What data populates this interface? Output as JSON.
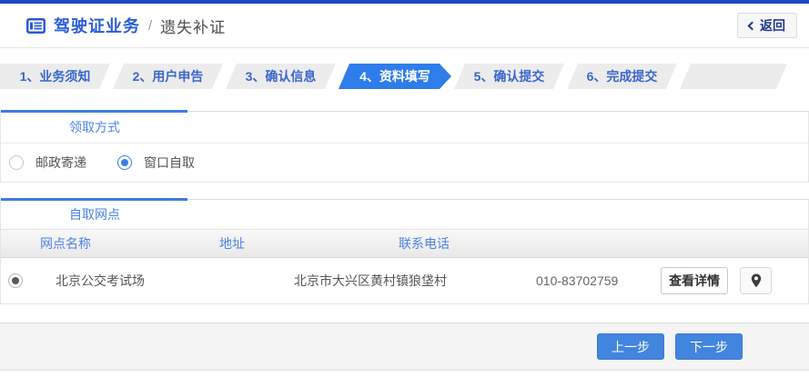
{
  "header": {
    "title_primary": "驾驶证业务",
    "title_separator": "/",
    "title_secondary": "遗失补证",
    "back_label": "返回"
  },
  "steps": [
    {
      "label": "1、业务须知",
      "active": false
    },
    {
      "label": "2、用户申告",
      "active": false
    },
    {
      "label": "3、确认信息",
      "active": false
    },
    {
      "label": "4、资料填写",
      "active": true
    },
    {
      "label": "5、确认提交",
      "active": false
    },
    {
      "label": "6、完成提交",
      "active": false
    }
  ],
  "pickup_section": {
    "title": "领取方式",
    "options": [
      {
        "label": "邮政寄递",
        "selected": false
      },
      {
        "label": "窗口自取",
        "selected": true
      }
    ]
  },
  "outlets_section": {
    "title": "自取网点",
    "columns": {
      "name": "网点名称",
      "address": "地址",
      "phone": "联系电话"
    },
    "rows": [
      {
        "selected": true,
        "name": "北京公交考试场",
        "address": "北京市大兴区黄村镇狼垡村",
        "phone": "010-83702759",
        "detail_label": "查看详情"
      }
    ]
  },
  "footer": {
    "prev_label": "上一步",
    "next_label": "下一步"
  },
  "icons": {
    "header": "card-list-icon",
    "back": "chevron-left-icon",
    "map": "location-pin-icon"
  },
  "colors": {
    "top_bar": "#1b48c4",
    "accent_blue": "#3e7ce4",
    "active_step": "#2f7ceb",
    "button_blue": "#4285df",
    "link_blue": "#2b5cd9",
    "step_text": "#3a66cf",
    "section_label": "#4d82e8"
  }
}
